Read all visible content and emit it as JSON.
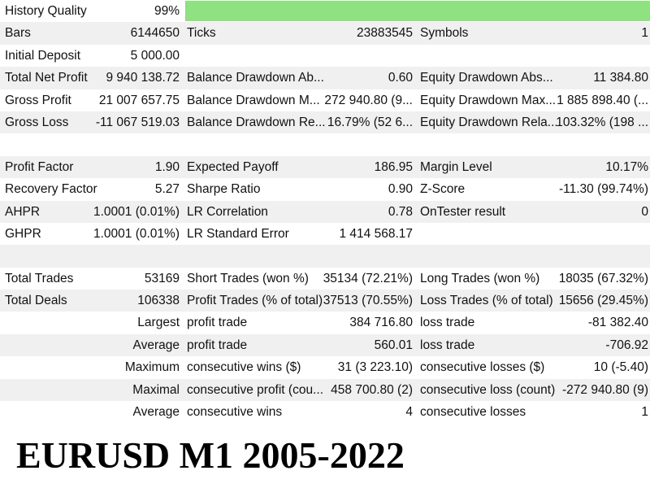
{
  "history_quality": {
    "label": "History Quality",
    "value": "99%",
    "fill_fraction": 0.99,
    "bar_color": "#8ee27f"
  },
  "row_shade_color": "#f0f0f0",
  "stats": {
    "bars": {
      "label": "Bars",
      "value": "6144650"
    },
    "ticks": {
      "label": "Ticks",
      "value": "23883545"
    },
    "symbols": {
      "label": "Symbols",
      "value": "1"
    },
    "initial_deposit": {
      "label": "Initial Deposit",
      "value": "5 000.00"
    },
    "total_net_profit": {
      "label": "Total Net Profit",
      "value": "9 940 138.72"
    },
    "balance_dd_abs": {
      "label": "Balance Drawdown Ab...",
      "value": "0.60"
    },
    "equity_dd_abs": {
      "label": "Equity Drawdown Abs...",
      "value": "11 384.80"
    },
    "gross_profit": {
      "label": "Gross Profit",
      "value": "21 007 657.75"
    },
    "balance_dd_max": {
      "label": "Balance Drawdown M...",
      "value": "272 940.80 (9..."
    },
    "equity_dd_max": {
      "label": "Equity Drawdown Max...",
      "value": "1 885 898.40 (..."
    },
    "gross_loss": {
      "label": "Gross Loss",
      "value": "-11 067 519.03"
    },
    "balance_dd_rel": {
      "label": "Balance Drawdown Re...",
      "value": "16.79% (52 6..."
    },
    "equity_dd_rel": {
      "label": "Equity Drawdown Rela...",
      "value": "103.32% (198 ..."
    },
    "profit_factor": {
      "label": "Profit Factor",
      "value": "1.90"
    },
    "expected_payoff": {
      "label": "Expected Payoff",
      "value": "186.95"
    },
    "margin_level": {
      "label": "Margin Level",
      "value": "10.17%"
    },
    "recovery_factor": {
      "label": "Recovery Factor",
      "value": "5.27"
    },
    "sharpe_ratio": {
      "label": "Sharpe Ratio",
      "value": "0.90"
    },
    "z_score": {
      "label": "Z-Score",
      "value": "-11.30 (99.74%)"
    },
    "ahpr": {
      "label": "AHPR",
      "value": "1.0001 (0.01%)"
    },
    "lr_correlation": {
      "label": "LR Correlation",
      "value": "0.78"
    },
    "ontester_result": {
      "label": "OnTester result",
      "value": "0"
    },
    "ghpr": {
      "label": "GHPR",
      "value": "1.0001 (0.01%)"
    },
    "lr_standard_error": {
      "label": "LR Standard Error",
      "value": "1 414 568.17"
    },
    "total_trades": {
      "label": "Total Trades",
      "value": "53169"
    },
    "short_trades": {
      "label": "Short Trades (won %)",
      "value": "35134 (72.21%)"
    },
    "long_trades": {
      "label": "Long Trades (won %)",
      "value": "18035 (67.32%)"
    },
    "total_deals": {
      "label": "Total Deals",
      "value": "106338"
    },
    "profit_trades": {
      "label": "Profit Trades (% of total)",
      "value": "37513 (70.55%)"
    },
    "loss_trades": {
      "label": "Loss Trades (% of total)",
      "value": "15656 (29.45%)"
    },
    "largest": {
      "label": "Largest",
      "profit_label": "profit trade",
      "profit_value": "384 716.80",
      "loss_label": "loss trade",
      "loss_value": "-81 382.40"
    },
    "average": {
      "label": "Average",
      "profit_label": "profit trade",
      "profit_value": "560.01",
      "loss_label": "loss trade",
      "loss_value": "-706.92"
    },
    "maximum": {
      "label": "Maximum",
      "profit_label": "consecutive wins ($)",
      "profit_value": "31 (3 223.10)",
      "loss_label": "consecutive losses ($)",
      "loss_value": "10 (-5.40)"
    },
    "maximal": {
      "label": "Maximal",
      "profit_label": "consecutive profit (cou...",
      "profit_value": "458 700.80 (2)",
      "loss_label": "consecutive loss (count)",
      "loss_value": "-272 940.80 (9)"
    },
    "average2": {
      "label": "Average",
      "profit_label": "consecutive wins",
      "profit_value": "4",
      "loss_label": "consecutive losses",
      "loss_value": "1"
    }
  },
  "caption": "EURUSD M1 2005-2022"
}
